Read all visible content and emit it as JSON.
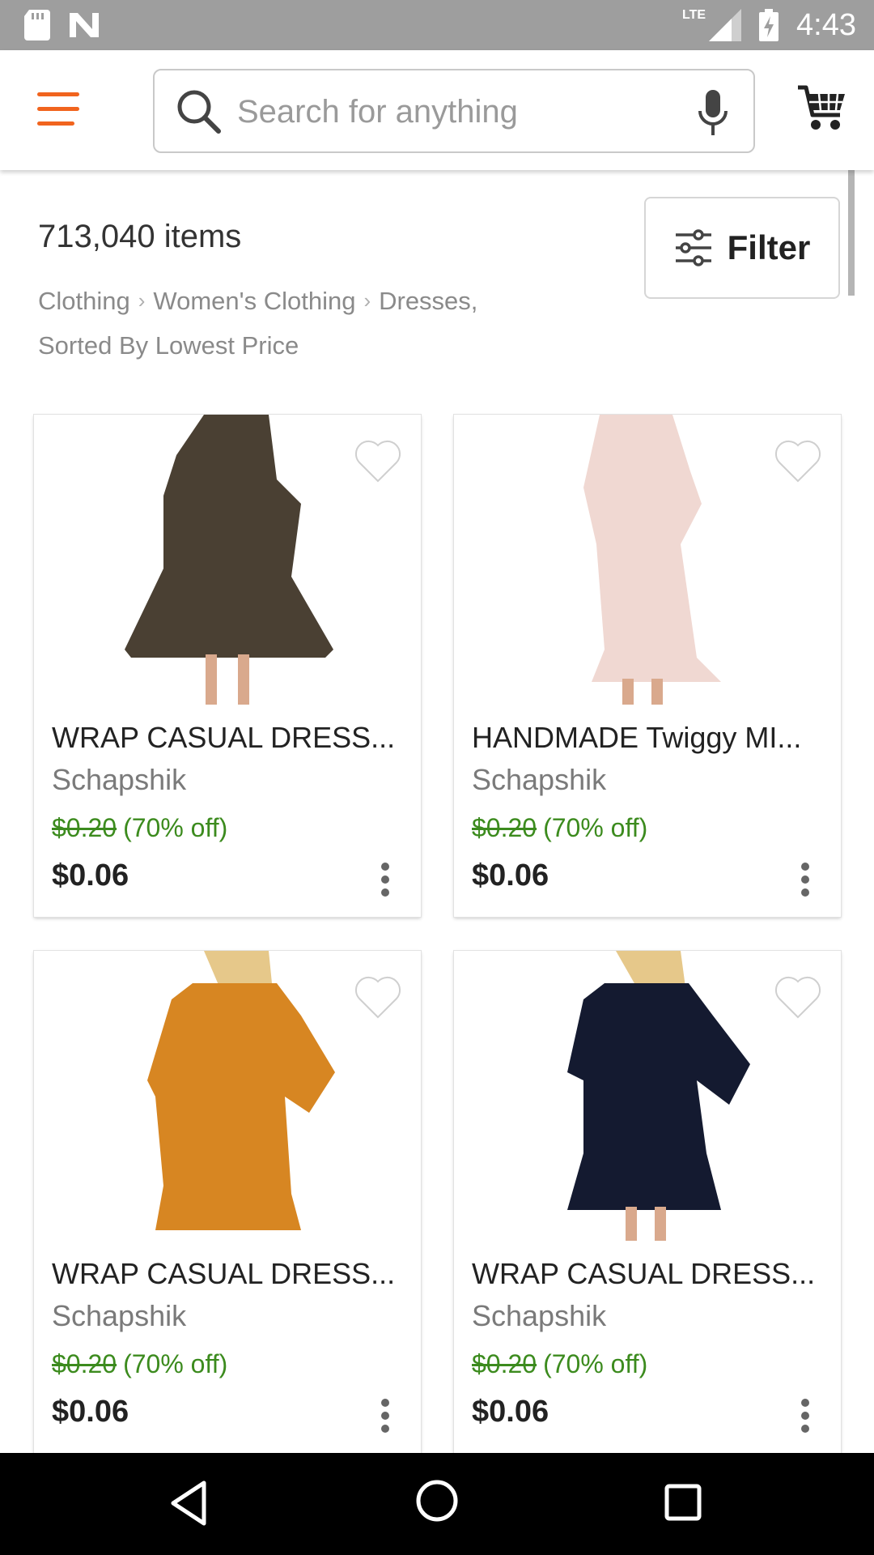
{
  "status_bar": {
    "time": "4:43",
    "network": "LTE"
  },
  "search": {
    "placeholder": "Search for anything"
  },
  "results": {
    "count_text": "713,040 items",
    "breadcrumb": [
      "Clothing",
      "Women's Clothing",
      "Dresses,"
    ],
    "sort_text": "Sorted By Lowest Price",
    "filter_label": "Filter"
  },
  "products": [
    {
      "title": "WRAP CASUAL DRESS...",
      "shop": "Schapshik",
      "original_price": "$0.20",
      "discount": "(70% off)",
      "price": "$0.06",
      "dress_color": "#4a4033"
    },
    {
      "title": "HANDMADE Twiggy MI...",
      "shop": "Schapshik",
      "original_price": "$0.20",
      "discount": "(70% off)",
      "price": "$0.06",
      "dress_color": "#f0d8d2"
    },
    {
      "title": "WRAP CASUAL DRESS...",
      "shop": "Schapshik",
      "original_price": "$0.20",
      "discount": "(70% off)",
      "price": "$0.06",
      "dress_color": "#d78622"
    },
    {
      "title": "WRAP CASUAL DRESS...",
      "shop": "Schapshik",
      "original_price": "$0.20",
      "discount": "(70% off)",
      "price": "$0.06",
      "dress_color": "#141a30"
    }
  ],
  "colors": {
    "accent": "#f1641e",
    "sale_green": "#3c8b1e"
  }
}
